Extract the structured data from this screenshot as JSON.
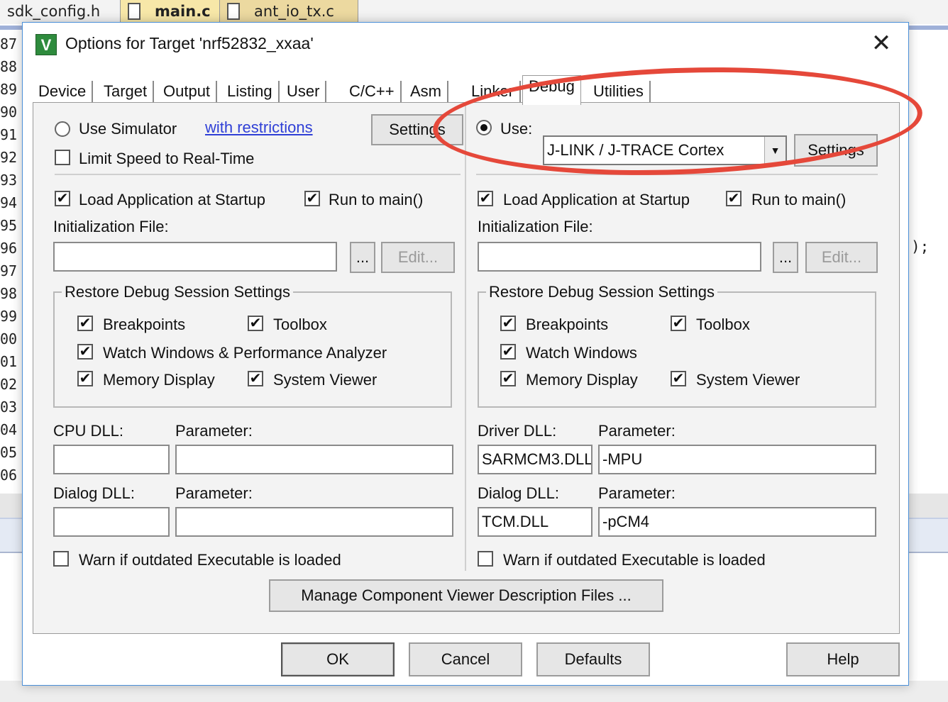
{
  "editor": {
    "tabs": [
      {
        "label": "sdk_config.h"
      },
      {
        "label": "main.c"
      },
      {
        "label": "ant_io_tx.c"
      }
    ],
    "line_numbers": [
      "87",
      "88",
      "89",
      "90",
      "91",
      "92",
      "93",
      "94",
      "95",
      "96",
      "97",
      "98",
      "99",
      "00",
      "01",
      "02",
      "03",
      "04",
      "05",
      "06"
    ],
    "code_fragment": ");"
  },
  "dialog": {
    "title": "Options for Target 'nrf52832_xxaa'",
    "close_glyph": "✕",
    "tabs": [
      "Device",
      "Target",
      "Output",
      "Listing",
      "User",
      "C/C++",
      "Asm",
      "Linker",
      "Debug",
      "Utilities"
    ],
    "active_tab": "Debug",
    "left": {
      "use_simulator": "Use Simulator",
      "restrictions_link": "with restrictions",
      "settings": "Settings",
      "limit_speed": "Limit Speed to Real-Time",
      "load_app": "Load Application at Startup",
      "run_to_main": "Run to main()",
      "init_file_label": "Initialization File:",
      "init_file_value": "",
      "browse": "...",
      "edit": "Edit...",
      "restore_group": "Restore Debug Session Settings",
      "breakpoints": "Breakpoints",
      "toolbox": "Toolbox",
      "watch_windows": "Watch Windows & Performance Analyzer",
      "memory_display": "Memory Display",
      "system_viewer": "System Viewer",
      "cpu_dll_label": "CPU DLL:",
      "cpu_param_label": "Parameter:",
      "cpu_dll_value": "",
      "cpu_param_value": "",
      "dialog_dll_label": "Dialog DLL:",
      "dialog_param_label": "Parameter:",
      "dialog_dll_value": "",
      "dialog_param_value": "",
      "warn": "Warn if outdated Executable is loaded"
    },
    "right": {
      "use_label": "Use:",
      "debugger_selected": "J-LINK / J-TRACE Cortex",
      "settings": "Settings",
      "load_app": "Load Application at Startup",
      "run_to_main": "Run to main()",
      "init_file_label": "Initialization File:",
      "init_file_value": "",
      "browse": "...",
      "edit": "Edit...",
      "restore_group": "Restore Debug Session Settings",
      "breakpoints": "Breakpoints",
      "toolbox": "Toolbox",
      "watch_windows": "Watch Windows",
      "memory_display": "Memory Display",
      "system_viewer": "System Viewer",
      "driver_dll_label": "Driver DLL:",
      "driver_param_label": "Parameter:",
      "driver_dll_value": "SARMCM3.DLL",
      "driver_param_value": "-MPU",
      "dialog_dll_label": "Dialog DLL:",
      "dialog_param_label": "Parameter:",
      "dialog_dll_value": "TCM.DLL",
      "dialog_param_value": "-pCM4",
      "warn": "Warn if outdated Executable is loaded"
    },
    "manage_button": "Manage Component Viewer Description Files ...",
    "footer": {
      "ok": "OK",
      "cancel": "Cancel",
      "defaults": "Defaults",
      "help": "Help"
    }
  },
  "check_glyph": "✔",
  "colors": {
    "annotation": "#e5483a",
    "link": "#2f3fd6",
    "dialog_border": "#4a8fd8"
  }
}
